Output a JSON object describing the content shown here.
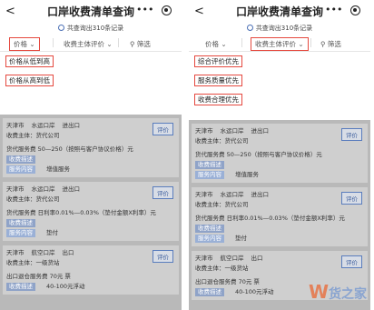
{
  "app": {
    "title": "口岸收费清单查询",
    "back": "<",
    "more": "•••",
    "result_count": "共查询出310条记录"
  },
  "filters": {
    "price": "价格",
    "evaluation": "收费主体评价",
    "screen": "筛选"
  },
  "left_dropdown": [
    "价格从低到高",
    "价格从高到低"
  ],
  "right_dropdown": [
    "综合评价优先",
    "服务质量优先",
    "收费合理优先"
  ],
  "cards": [
    {
      "city": "天津市",
      "port": "水运口岸",
      "direction": "进出口",
      "subject": "收费主体：货代公司",
      "evaluate_btn": "评价",
      "line1": "货代服务费  50—250（按照与客户协议价格）元",
      "tag1": "收费描述",
      "tag2": "服务内容",
      "content": "增值服务"
    },
    {
      "city": "天津市",
      "port": "水运口岸",
      "direction": "进出口",
      "subject": "收费主体：货代公司",
      "evaluate_btn": "评价",
      "line1": "货代服务费  日利率0.01%—0.03%（垫付金额X利率）元",
      "tag1": "收费描述",
      "tag2": "服务内容",
      "content": "垫付"
    },
    {
      "city": "天津市",
      "port": "航空口岸",
      "direction": "出口",
      "subject": "收费主体：一级货站",
      "evaluate_btn": "评价",
      "line1": "出口退仓服务费  70元  票",
      "tag1": "收费描述",
      "content": "40-100元浮动"
    }
  ],
  "watermark": {
    "mark": "W",
    "text": "货之家"
  }
}
